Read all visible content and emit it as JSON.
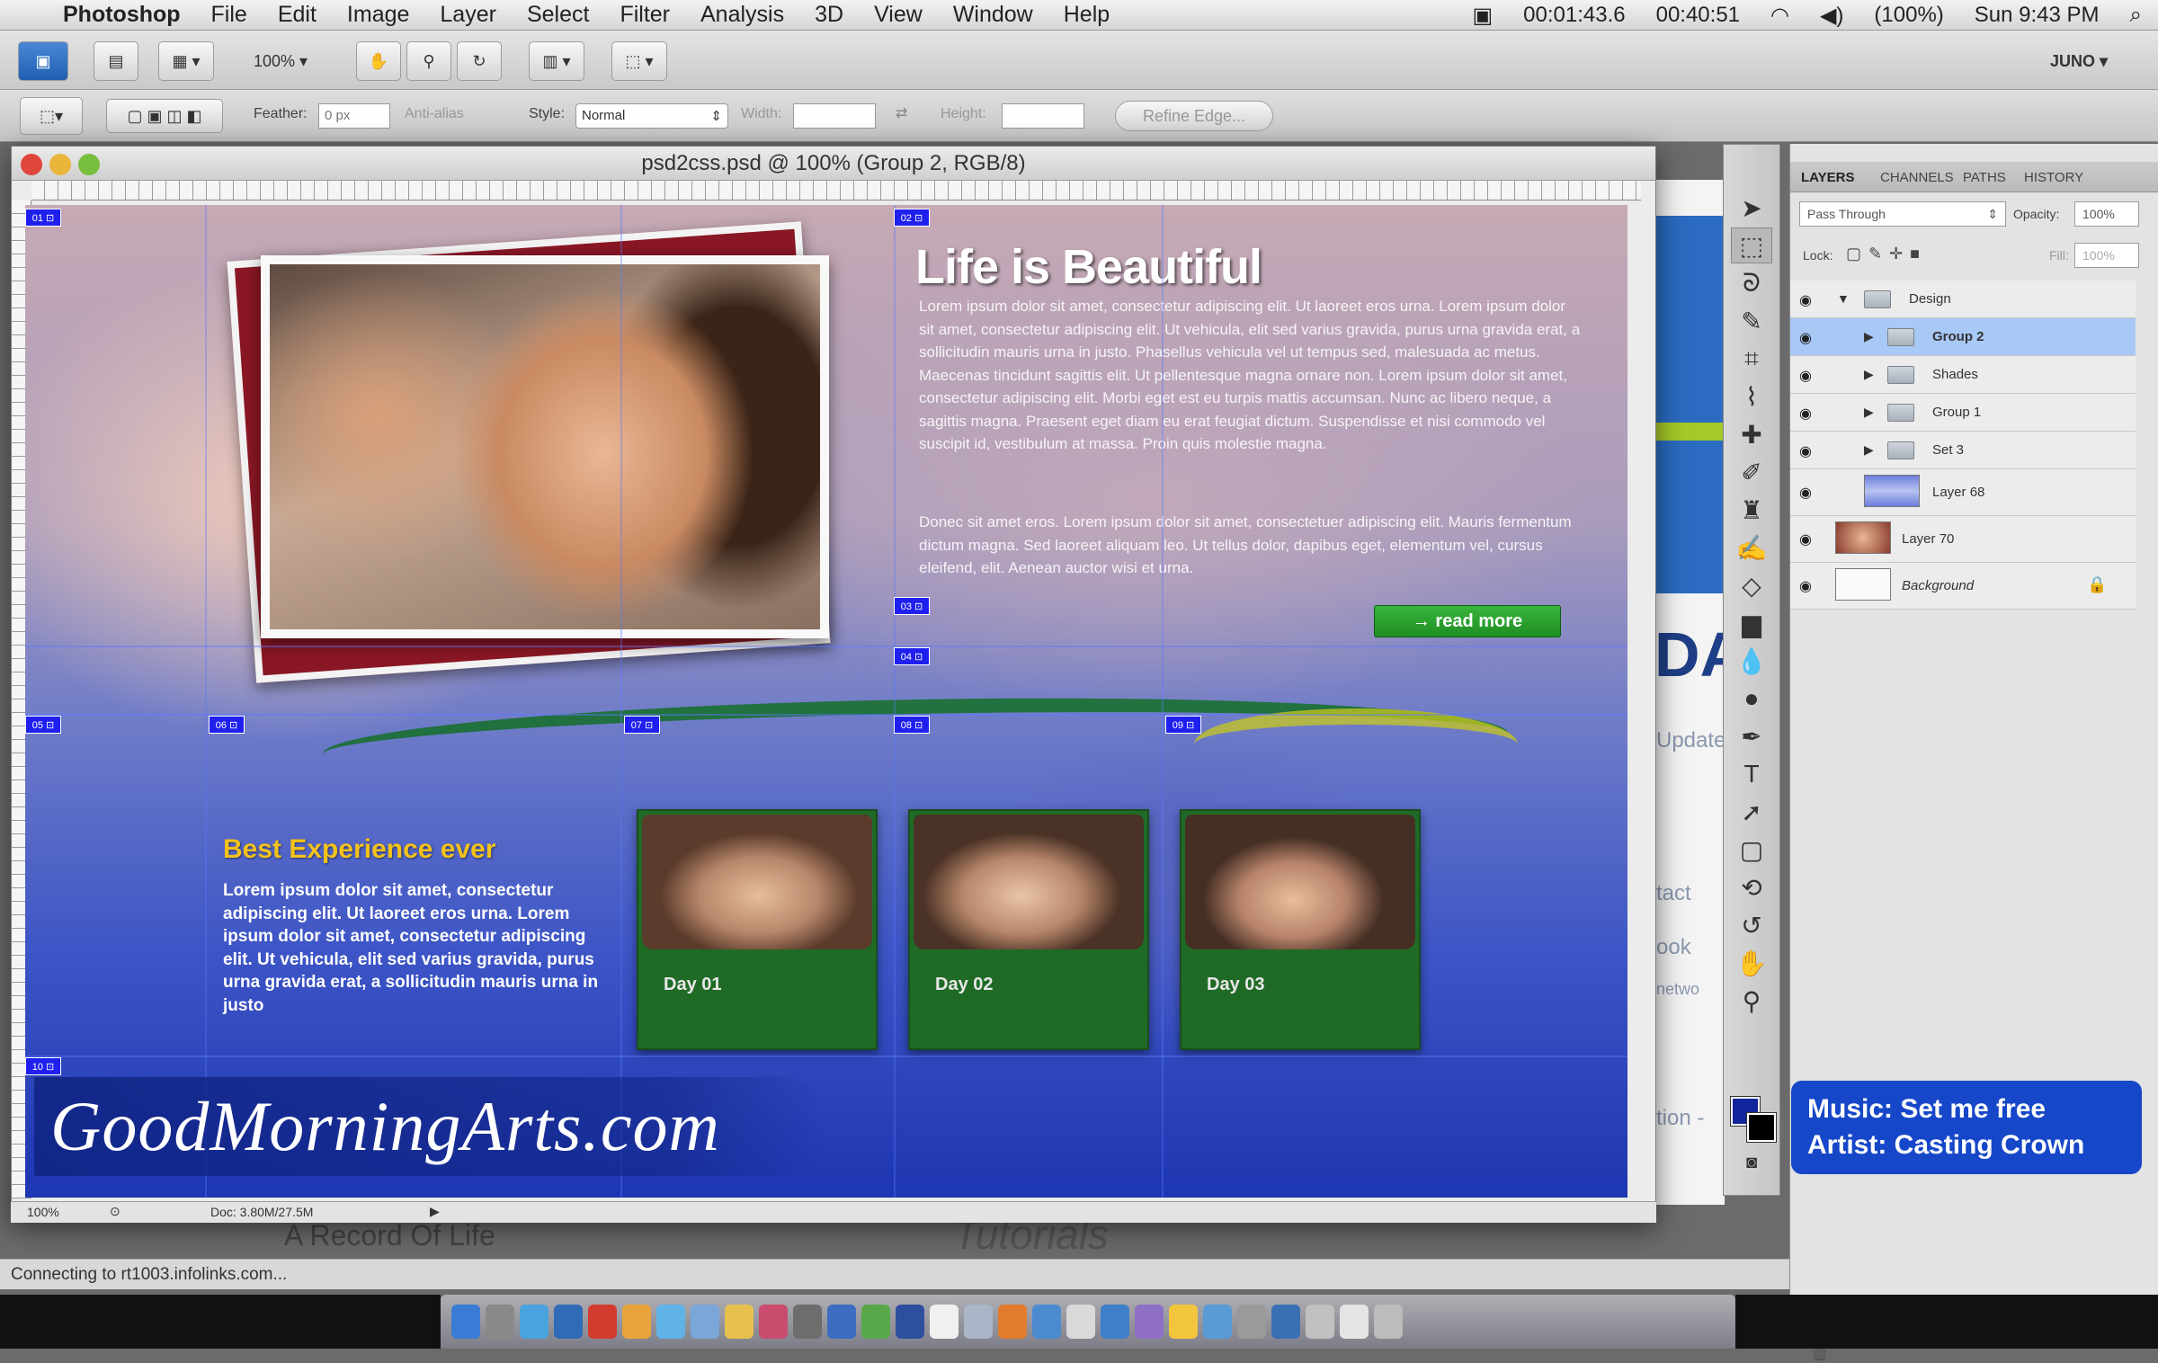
{
  "menubar": {
    "app_name": "Photoshop",
    "items": [
      "File",
      "Edit",
      "Image",
      "Layer",
      "Select",
      "Filter",
      "Analysis",
      "3D",
      "View",
      "Window",
      "Help"
    ],
    "timer": "00:01:43.6",
    "timer2": "00:40:51",
    "battery": "(100%)",
    "clock": "Sun 9:43 PM"
  },
  "appbar": {
    "zoom": "100%",
    "workspace": "JUNO"
  },
  "options_bar": {
    "feather_label": "Feather:",
    "feather_value": "0 px",
    "anti_alias": "Anti-alias",
    "style_label": "Style:",
    "style_value": "Normal",
    "width_label": "Width:",
    "height_label": "Height:",
    "refine_edge": "Refine Edge..."
  },
  "document": {
    "title": "psd2css.psd @ 100% (Group 2, RGB/8)",
    "status_zoom": "100%",
    "doc_size": "Doc: 3.80M/27.5M"
  },
  "canvas": {
    "headline": "Life is Beautiful",
    "para1": "Lorem ipsum dolor sit amet, consectetur adipiscing elit. Ut laoreet eros urna. Lorem ipsum dolor sit amet, consectetur adipiscing elit. Ut vehicula, elit sed varius gravida, purus urna gravida erat, a sollicitudin mauris urna in justo. Phasellus vehicula vel ut tempus sed, malesuada ac metus. Maecenas tincidunt sagittis elit. Ut pellentesque magna ornare non. Lorem ipsum dolor sit amet, consectetur adipiscing elit. Morbi eget est eu turpis mattis accumsan. Nunc ac libero neque, a sagittis magna. Praesent eget diam eu erat feugiat dictum. Suspendisse et nisi commodo vel suscipit id, vestibulum at massa. Proin quis molestie magna.",
    "para2": "Donec sit amet eros. Lorem ipsum dolor sit amet, consectetuer adipiscing elit. Mauris fermentum dictum magna. Sed laoreet aliquam leo. Ut tellus dolor, dapibus eget, elementum vel, cursus eleifend, elit. Aenean auctor wisi et urna.",
    "read_more": "→ read more",
    "box_title": "Best Experience ever",
    "box_text": "Lorem ipsum dolor sit amet, consectetur adipiscing elit. Ut laoreet eros urna. Lorem ipsum dolor sit amet, consectetur adipiscing elit. Ut vehicula, elit sed varius gravida, purus urna gravida erat, a sollicitudin mauris urna in justo",
    "days": [
      "Day 01",
      "Day 02",
      "Day 03"
    ],
    "watermark": "GoodMorningArts.com"
  },
  "background_page": {
    "strip_big": "DAY",
    "strip_texts": [
      "Update",
      "tact",
      "ook",
      "netwo",
      "tion -"
    ],
    "below_text": "A Record Of Life",
    "below_tutorials": "Tutorials"
  },
  "statusline": "Connecting to rt1003.infolinks.com...",
  "layers_panel": {
    "tabs": [
      "LAYERS",
      "CHANNELS",
      "PATHS",
      "HISTORY"
    ],
    "blend_mode": "Pass Through",
    "opacity_label": "Opacity:",
    "opacity": "100%",
    "lock_label": "Lock:",
    "fill_label": "Fill:",
    "fill": "100%",
    "layers": [
      {
        "name": "Design",
        "type": "group",
        "expanded": true,
        "selected": false
      },
      {
        "name": "Group 2",
        "type": "group",
        "expanded": false,
        "selected": true
      },
      {
        "name": "Shades",
        "type": "group",
        "expanded": false,
        "selected": false
      },
      {
        "name": "Group 1",
        "type": "group",
        "expanded": false,
        "selected": false
      },
      {
        "name": "Set 3",
        "type": "group",
        "expanded": false,
        "selected": false
      },
      {
        "name": "Layer 68",
        "type": "layer",
        "selected": false
      },
      {
        "name": "Layer 70",
        "type": "layer",
        "selected": false
      },
      {
        "name": "Background",
        "type": "layer",
        "locked": true,
        "selected": false
      }
    ]
  },
  "music_overlay": {
    "music": "Music: Set me free",
    "artist": "Artist: Casting Crown"
  },
  "colors": {
    "foreground": "#10259c",
    "background": "#000000",
    "read_more": "#2aa32e",
    "box_title": "#f3c21c",
    "music_bg": "#1547c8"
  }
}
